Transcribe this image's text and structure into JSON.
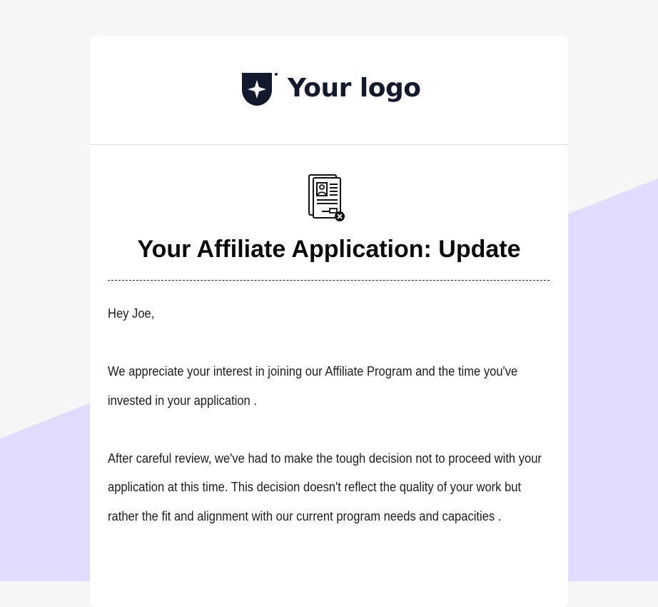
{
  "colors": {
    "page_background": "#f6f6f6",
    "wedge": "#e0dcff",
    "card": "#ffffff",
    "logo": "#15192e"
  },
  "logo": {
    "icon": "shield-star-logo-icon",
    "text": "Your logo"
  },
  "email": {
    "icon": "rejected-document-icon",
    "title": "Your Affiliate Application: Update",
    "greeting": "Hey Joe,",
    "paragraphs": [
      "We appreciate your interest in joining our Affiliate Program and the time you've invested in your application .",
      "After careful review, we've had to make the tough decision not to proceed with your application at this time. This decision doesn't reflect the quality of your work but rather the fit and alignment with our current program needs and capacities ."
    ]
  }
}
